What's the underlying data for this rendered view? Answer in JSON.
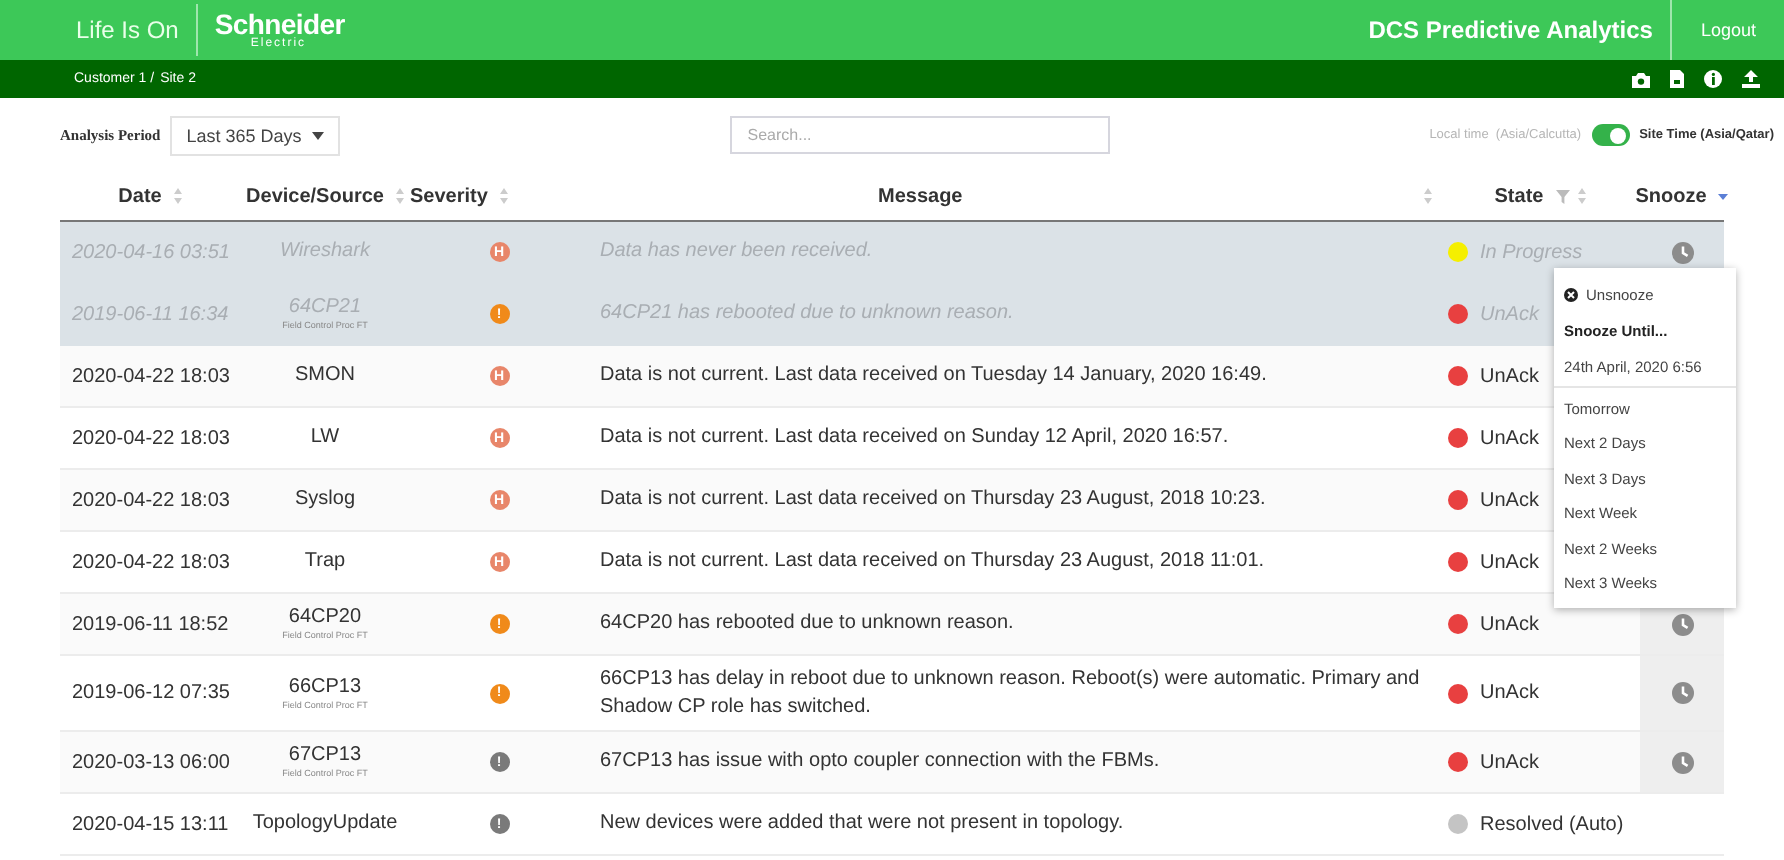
{
  "header": {
    "tagline": "Life Is On",
    "brand": "Schneider",
    "brand_sub": "Electric",
    "app_title": "DCS Predictive Analytics",
    "logout": "Logout"
  },
  "breadcrumb": [
    "Customer 1 /",
    "Site 2"
  ],
  "toolbar": {
    "period_label": "Analysis Period",
    "period_value": "Last 365 Days",
    "search_placeholder": "Search...",
    "local_time": "Local time",
    "local_zone": "(Asia/Calcutta)",
    "site_time": "Site Time (Asia/Qatar)",
    "site_time_on": true
  },
  "table": {
    "columns": [
      {
        "label": "Date",
        "kind": "sort"
      },
      {
        "label": "Device/Source",
        "kind": "sort"
      },
      {
        "label": "Severity",
        "kind": "sort"
      },
      {
        "label": "Message",
        "kind": "sort"
      },
      {
        "label": "State",
        "kind": "filter"
      },
      {
        "label": "Snooze",
        "kind": "sorted"
      }
    ],
    "rows": [
      {
        "date": "2020-04-16 03:51",
        "device": "Wireshark",
        "severity": {
          "kind": "high",
          "label": "H"
        },
        "message": "Data has never been received.",
        "state": {
          "label": "In Progress",
          "color": "#f5ef00"
        },
        "snoozed": true,
        "snooze_icon": true
      },
      {
        "date": "2019-06-11 16:34",
        "device": "64CP21",
        "sub": "Field Control Proc FT",
        "severity": {
          "kind": "warning",
          "label": "!"
        },
        "message": "64CP21 has rebooted due to unknown reason.",
        "state": {
          "label": "UnAck",
          "color": "#e84040"
        },
        "snoozed": true
      },
      {
        "date": "2020-04-22 18:03",
        "device": "SMON",
        "severity": {
          "kind": "high",
          "label": "H"
        },
        "message": "Data is not current. Last data received on Tuesday 14 January, 2020 16:49.",
        "state": {
          "label": "UnAck",
          "color": "#e84040"
        },
        "snoozed": false
      },
      {
        "date": "2020-04-22 18:03",
        "device": "LW",
        "severity": {
          "kind": "high",
          "label": "H"
        },
        "message": "Data is not current. Last data received on Sunday 12 April, 2020 16:57.",
        "state": {
          "label": "UnAck",
          "color": "#e84040"
        },
        "snoozed": false
      },
      {
        "date": "2020-04-22 18:03",
        "device": "Syslog",
        "severity": {
          "kind": "high",
          "label": "H"
        },
        "message": "Data is not current. Last data received on Thursday 23 August, 2018 10:23.",
        "state": {
          "label": "UnAck",
          "color": "#e84040"
        },
        "snoozed": false
      },
      {
        "date": "2020-04-22 18:03",
        "device": "Trap",
        "severity": {
          "kind": "high",
          "label": "H"
        },
        "message": "Data is not current. Last data received on Thursday 23 August, 2018 11:01.",
        "state": {
          "label": "UnAck",
          "color": "#e84040"
        },
        "snoozed": false
      },
      {
        "date": "2019-06-11 18:52",
        "device": "64CP20",
        "sub": "Field Control Proc FT",
        "severity": {
          "kind": "warning",
          "label": "!"
        },
        "message": "64CP20 has rebooted due to unknown reason.",
        "state": {
          "label": "UnAck",
          "color": "#e84040"
        },
        "snoozed": false,
        "snooze_icon": true
      },
      {
        "date": "2019-06-12 07:35",
        "device": "66CP13",
        "sub": "Field Control Proc FT",
        "severity": {
          "kind": "warning",
          "label": "!"
        },
        "message": "66CP13 has delay in reboot due to unknown reason. Reboot(s) were automatic. Primary and Shadow CP role has switched.",
        "state": {
          "label": "UnAck",
          "color": "#e84040"
        },
        "snoozed": false,
        "snooze_icon": true
      },
      {
        "date": "2020-03-13 06:00",
        "device": "67CP13",
        "sub": "Field Control Proc FT",
        "severity": {
          "kind": "info",
          "label": "!"
        },
        "message": "67CP13 has issue with opto coupler connection with the FBMs.",
        "state": {
          "label": "UnAck",
          "color": "#e84040"
        },
        "snoozed": false,
        "snooze_icon": true
      },
      {
        "date": "2020-04-15 13:11",
        "device": "TopologyUpdate",
        "severity": {
          "kind": "info",
          "label": "!"
        },
        "message": "New devices were added that were not present in topology.",
        "state": {
          "label": "Resolved (Auto)",
          "color": "#c4c4c4"
        },
        "snoozed": false,
        "snooze_icon": false
      }
    ]
  },
  "snooze_menu": {
    "unsnooze": "Unsnooze",
    "heading": "Snooze Until...",
    "date": "24th April, 2020 6:56",
    "options": [
      "Tomorrow",
      "Next 2 Days",
      "Next 3 Days",
      "Next Week",
      "Next 2 Weeks",
      "Next 3 Weeks"
    ]
  }
}
